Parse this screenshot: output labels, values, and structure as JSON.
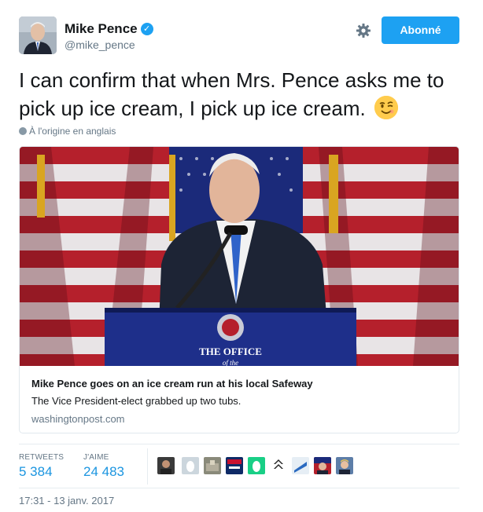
{
  "user": {
    "name": "Mike Pence",
    "handle": "@mike_pence",
    "verified_icon": "verified-badge-icon"
  },
  "header": {
    "settings_icon": "gear-icon",
    "follow_label": "Abonné"
  },
  "tweet": {
    "text": "I can confirm that when Mrs. Pence asks me to pick up ice cream, I pick up ice cream.",
    "emoji": "winking-face-icon",
    "translation_note": "À l'origine en anglais"
  },
  "card": {
    "title": "Mike Pence goes on an ice cream run at his local Safeway",
    "description": "The Vice President-elect grabbed up two tubs.",
    "domain": "washingtonpost.com",
    "podium_text_1": "THE OFFICE",
    "podium_text_2": "of the"
  },
  "stats": {
    "retweets_label": "RETWEETS",
    "retweets_value": "5 384",
    "likes_label": "J'AIME",
    "likes_value": "24 483"
  },
  "timestamp": "17:31 - 13 janv. 2017",
  "colors": {
    "accent": "#1da1f2",
    "link": "#1b95e0",
    "muted": "#657786"
  }
}
